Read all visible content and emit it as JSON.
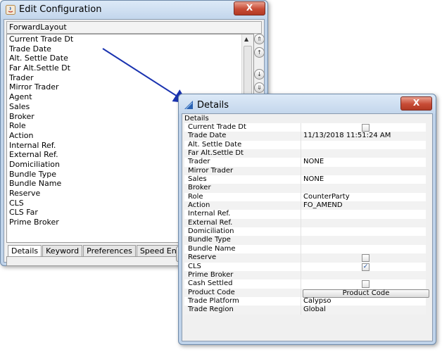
{
  "edit_window": {
    "title": "Edit Configuration",
    "close_label": "X",
    "layout_name": "ForwardLayout",
    "fields": [
      "Current Trade Dt",
      "Trade Date",
      "Alt. Settle Date",
      "Far Alt.Settle Dt",
      "Trader",
      "Mirror Trader",
      "Agent",
      "Sales",
      "Broker",
      "Role",
      "Action",
      "Internal Ref.",
      "External Ref.",
      "Domiciliation",
      "Bundle Type",
      "Bundle Name",
      "Reserve",
      "CLS",
      "CLS Far",
      "Prime Broker"
    ],
    "tabs": [
      "Details",
      "Keyword",
      "Preferences",
      "Speed Entry"
    ]
  },
  "details_window": {
    "title": "Details",
    "close_label": "X",
    "header": "Details",
    "rows": [
      {
        "label": "Current Trade Dt",
        "value": "",
        "checkbox": true,
        "checked": false
      },
      {
        "label": "Trade Date",
        "value": "11/13/2018 11:51:24 AM"
      },
      {
        "label": "Alt. Settle Date",
        "value": ""
      },
      {
        "label": "Far Alt.Settle Dt",
        "value": ""
      },
      {
        "label": "Trader",
        "value": "NONE"
      },
      {
        "label": "Mirror Trader",
        "value": ""
      },
      {
        "label": "Sales",
        "value": "NONE"
      },
      {
        "label": "Broker",
        "value": ""
      },
      {
        "label": "Role",
        "value": "CounterParty"
      },
      {
        "label": "Action",
        "value": "FO_AMEND"
      },
      {
        "label": "Internal Ref.",
        "value": ""
      },
      {
        "label": "External Ref.",
        "value": ""
      },
      {
        "label": "Domiciliation",
        "value": ""
      },
      {
        "label": "Bundle Type",
        "value": ""
      },
      {
        "label": "Bundle Name",
        "value": ""
      },
      {
        "label": "Reserve",
        "value": "",
        "checkbox": true,
        "checked": false
      },
      {
        "label": "CLS",
        "value": "",
        "checkbox": true,
        "checked": true
      },
      {
        "label": "Prime Broker",
        "value": ""
      },
      {
        "label": "Cash Settled",
        "value": "",
        "checkbox": true,
        "checked": false
      },
      {
        "label": "Product Code",
        "value": "",
        "button": "Product Code"
      },
      {
        "label": "Trade Platform",
        "value": "Calypso"
      },
      {
        "label": "Trade Region",
        "value": "Global"
      }
    ]
  },
  "colors": {
    "accent": "#1a33b0",
    "window_frame": "#bfd3ea",
    "close": "#c74b35"
  }
}
